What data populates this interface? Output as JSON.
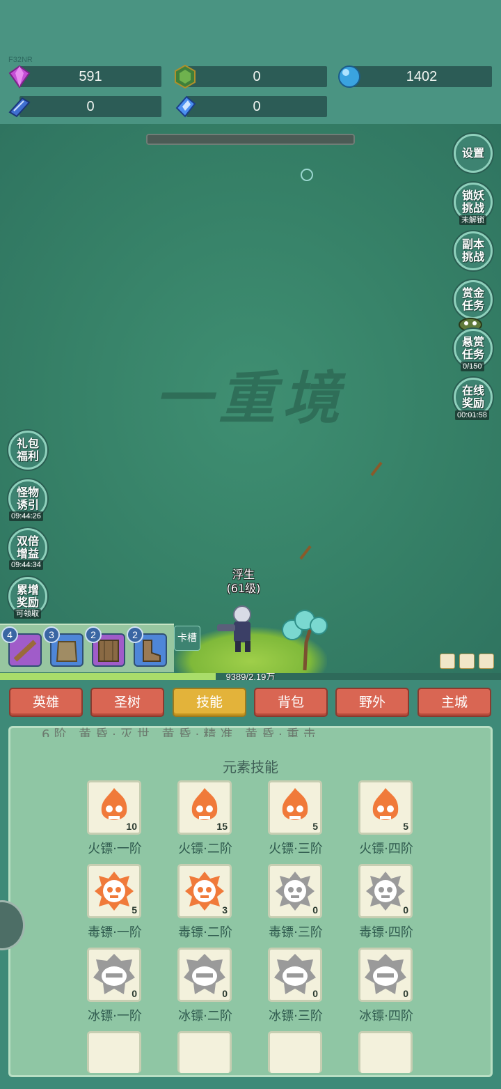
{
  "device_tag": "F32NR",
  "resources": [
    {
      "name": "purple-gem",
      "value": "591"
    },
    {
      "name": "green-crest",
      "value": "0"
    },
    {
      "name": "blue-orb",
      "value": "1402"
    },
    {
      "name": "skill-book",
      "value": "0"
    },
    {
      "name": "blue-crystal",
      "value": "0"
    }
  ],
  "realm_text": "一重境",
  "right_buttons": {
    "settings": "设置",
    "demon_challenge": "锁妖\n挑战",
    "demon_challenge_sub": "未解锁",
    "dungeon_challenge": "副本\n挑战",
    "bounty_task": "赏金\n任务",
    "reward_task": "悬赏\n任务",
    "reward_task_sub": "0/150",
    "online_reward": "在线\n奖励",
    "online_reward_sub": "00:01:58"
  },
  "left_buttons": {
    "gift": "礼包\n福利",
    "lure": "怪物\n诱引",
    "lure_sub": "09:44:26",
    "double": "双倍\n增益",
    "double_sub": "09:44:34",
    "accum": "累增\n奖励",
    "accum_sub": "可领取"
  },
  "hero": {
    "name": "浮生",
    "level": "(61级)"
  },
  "equipment": [
    {
      "slot": "weapon",
      "count": "4",
      "color": "#a05cc9"
    },
    {
      "slot": "armor",
      "count": "3",
      "color": "#4e86d8"
    },
    {
      "slot": "shield",
      "count": "2",
      "color": "#a05cc9"
    },
    {
      "slot": "boots",
      "count": "2",
      "color": "#4e86d8"
    }
  ],
  "card_slot_label": "卡槽",
  "exp": {
    "text": "9389/2.19万",
    "ratio": 0.43
  },
  "nav_tabs": [
    "英雄",
    "圣树",
    "技能",
    "背包",
    "野外",
    "主城"
  ],
  "nav_active": "技能",
  "cut_text": "6阶   黄昏·灭世   黄昏·精准   黄昏·重击",
  "section_title": "元素技能",
  "skills": [
    {
      "label": "火镖·一阶",
      "count": "10",
      "type": "fire",
      "active": true
    },
    {
      "label": "火镖·二阶",
      "count": "15",
      "type": "fire",
      "active": true
    },
    {
      "label": "火镖·三阶",
      "count": "5",
      "type": "fire",
      "active": true
    },
    {
      "label": "火镖·四阶",
      "count": "5",
      "type": "fire",
      "active": true
    },
    {
      "label": "毒镖·一阶",
      "count": "5",
      "type": "poison",
      "active": true
    },
    {
      "label": "毒镖·二阶",
      "count": "3",
      "type": "poison",
      "active": true
    },
    {
      "label": "毒镖·三阶",
      "count": "0",
      "type": "poison",
      "active": false
    },
    {
      "label": "毒镖·四阶",
      "count": "0",
      "type": "poison",
      "active": false
    },
    {
      "label": "冰镖·一阶",
      "count": "0",
      "type": "ice",
      "active": false
    },
    {
      "label": "冰镖·二阶",
      "count": "0",
      "type": "ice",
      "active": false
    },
    {
      "label": "冰镖·三阶",
      "count": "0",
      "type": "ice",
      "active": false
    },
    {
      "label": "冰镖·四阶",
      "count": "0",
      "type": "ice",
      "active": false
    }
  ],
  "colors": {
    "accent_active_tab": "#e3b33a",
    "tab": "#d96653",
    "skill_orange": "#f07a3a",
    "skill_gray": "#9a9a9a"
  }
}
